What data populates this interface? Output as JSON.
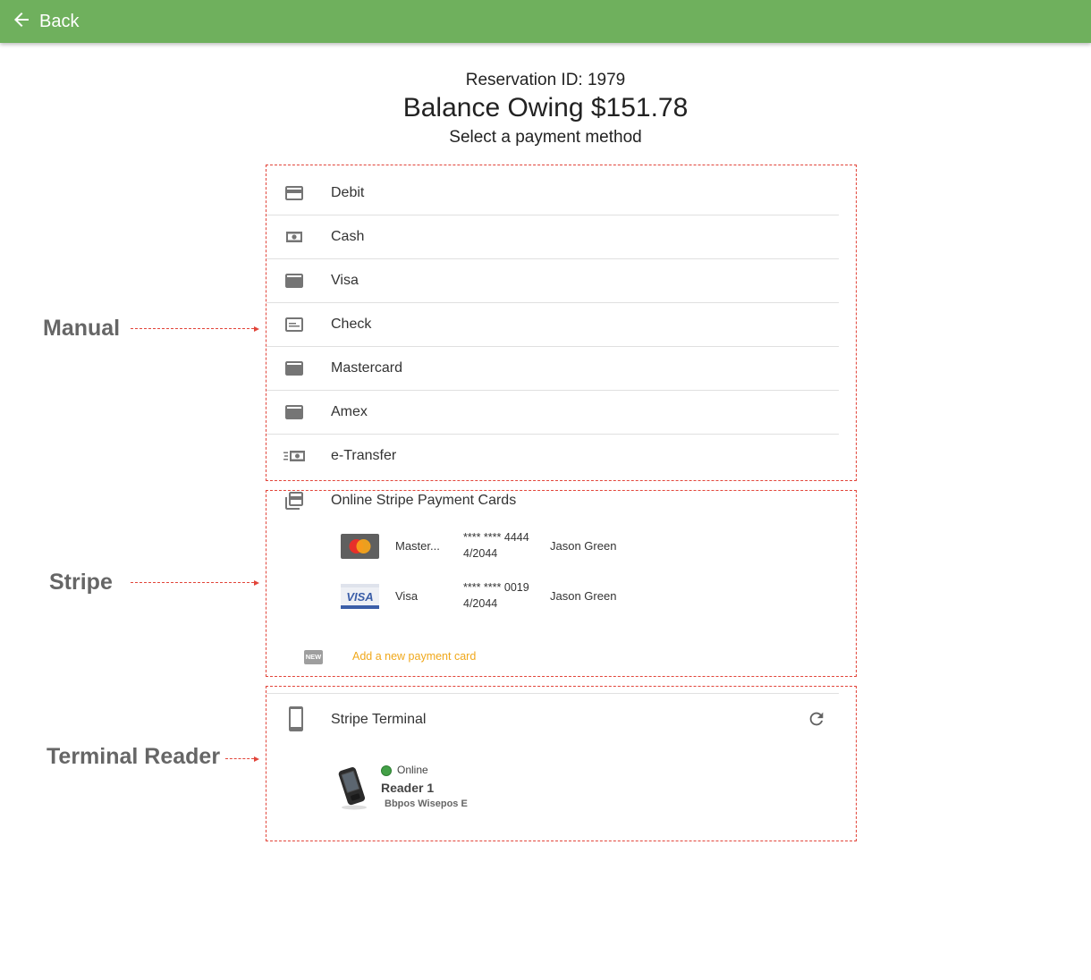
{
  "appbar": {
    "back_label": "Back",
    "color": "#6fb05d"
  },
  "header": {
    "reservation": "Reservation ID: 1979",
    "balance": "Balance Owing $151.78",
    "subtitle": "Select a payment method"
  },
  "annotations": {
    "manual": "Manual",
    "stripe": "Stripe",
    "terminal": "Terminal Reader",
    "accent": "#e2453a"
  },
  "manual_methods": [
    {
      "label": "Debit",
      "icon": "credit-card-outline-icon"
    },
    {
      "label": "Cash",
      "icon": "cash-icon"
    },
    {
      "label": "Visa",
      "icon": "credit-card-icon"
    },
    {
      "label": "Check",
      "icon": "check-icon"
    },
    {
      "label": "Mastercard",
      "icon": "credit-card-icon"
    },
    {
      "label": "Amex",
      "icon": "credit-card-icon"
    },
    {
      "label": "e-Transfer",
      "icon": "cash-fast-icon"
    }
  ],
  "stripe": {
    "title": "Online Stripe Payment Cards",
    "cards": [
      {
        "brand": "Master...",
        "number": "**** **** 4444",
        "expiry": "4/2044",
        "holder": "Jason Green",
        "logo": "mastercard-logo"
      },
      {
        "brand": "Visa",
        "number": "**** **** 0019",
        "expiry": "4/2044",
        "holder": "Jason Green",
        "logo": "visa-logo"
      }
    ],
    "add_badge": "NEW",
    "add_label": "Add a new payment card",
    "add_color": "#f0a81b"
  },
  "terminal": {
    "title": "Stripe Terminal",
    "reader": {
      "status": "Online",
      "status_color": "#43a047",
      "name": "Reader 1",
      "model": "Bbpos Wisepos E"
    }
  }
}
